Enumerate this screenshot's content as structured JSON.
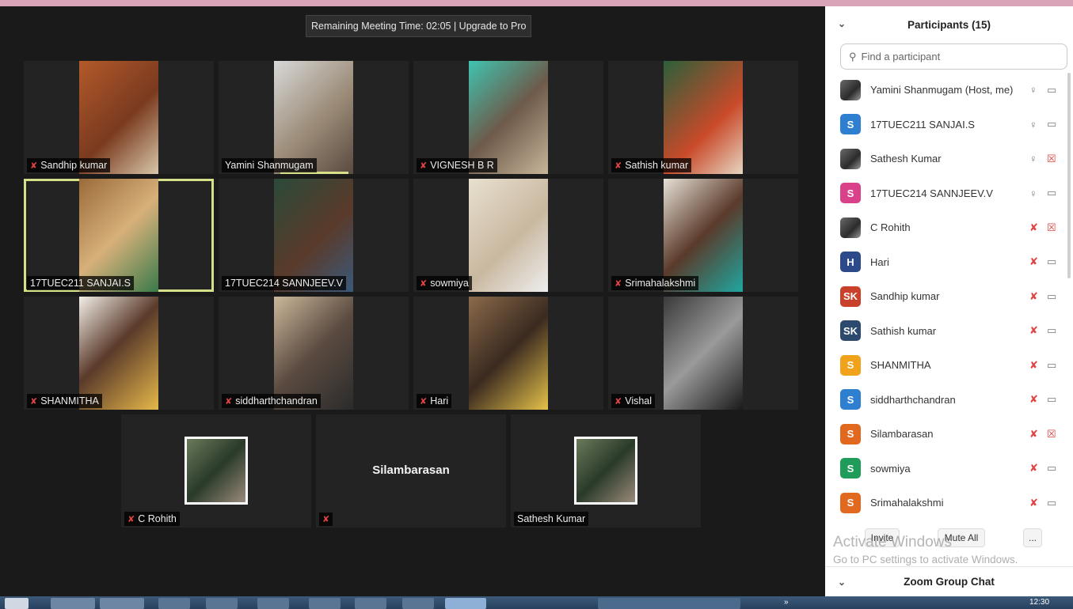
{
  "meeting": {
    "timer": "Remaining Meeting Time: 02:05 | Upgrade to Pro"
  },
  "tiles": [
    {
      "name": "Sandhip kumar",
      "muted": true,
      "video": true,
      "active": false
    },
    {
      "name": "Yamini Shanmugam",
      "muted": false,
      "video": true,
      "active": false
    },
    {
      "name": "VIGNESH B R",
      "muted": true,
      "video": true,
      "active": false
    },
    {
      "name": "Sathish kumar",
      "muted": true,
      "video": true,
      "active": false
    },
    {
      "name": "17TUEC211 SANJAI.S",
      "muted": false,
      "video": true,
      "active": true
    },
    {
      "name": "17TUEC214 SANNJEEV.V",
      "muted": false,
      "video": true,
      "active": false
    },
    {
      "name": "sowmiya",
      "muted": true,
      "video": true,
      "active": false
    },
    {
      "name": "Srimahalakshmi",
      "muted": true,
      "video": true,
      "active": false
    },
    {
      "name": "SHANMITHA",
      "muted": true,
      "video": true,
      "active": false
    },
    {
      "name": "siddharthchandran",
      "muted": true,
      "video": true,
      "active": false
    },
    {
      "name": "Hari",
      "muted": true,
      "video": true,
      "active": false
    },
    {
      "name": "Vishal",
      "muted": true,
      "video": true,
      "active": false
    },
    {
      "name": "C Rohith",
      "muted": true,
      "video": false,
      "active": false
    },
    {
      "name": "",
      "center_name": "Silambarasan",
      "muted": true,
      "video": false,
      "active": false
    },
    {
      "name": "Sathesh Kumar",
      "muted": false,
      "video": false,
      "active": false
    }
  ],
  "panel": {
    "title": "Participants (15)",
    "search_placeholder": "Find a participant",
    "participants": [
      {
        "initials": "",
        "name": "Yamini Shanmugam (Host, me)",
        "color": "#888888",
        "photo": true,
        "mic_off": false,
        "cam_off": false
      },
      {
        "initials": "S",
        "name": "17TUEC211 SANJAI.S",
        "color": "#2f7fd1",
        "photo": false,
        "mic_off": false,
        "cam_off": false
      },
      {
        "initials": "",
        "name": "Sathesh Kumar",
        "color": "#555555",
        "photo": true,
        "mic_off": false,
        "cam_off": true
      },
      {
        "initials": "S",
        "name": "17TUEC214 SANNJEEV.V",
        "color": "#d9418a",
        "photo": false,
        "mic_off": false,
        "cam_off": false
      },
      {
        "initials": "",
        "name": "C Rohith",
        "color": "#777777",
        "photo": true,
        "mic_off": true,
        "cam_off": true
      },
      {
        "initials": "H",
        "name": "Hari",
        "color": "#2c4a8a",
        "photo": false,
        "mic_off": true,
        "cam_off": false
      },
      {
        "initials": "SK",
        "name": "Sandhip kumar",
        "color": "#c9402b",
        "photo": false,
        "mic_off": true,
        "cam_off": false
      },
      {
        "initials": "SK",
        "name": "Sathish kumar",
        "color": "#2c4a6e",
        "photo": false,
        "mic_off": true,
        "cam_off": false
      },
      {
        "initials": "S",
        "name": "SHANMITHA",
        "color": "#f0a21a",
        "photo": false,
        "mic_off": true,
        "cam_off": false
      },
      {
        "initials": "S",
        "name": "siddharthchandran",
        "color": "#2f7fd1",
        "photo": false,
        "mic_off": true,
        "cam_off": false
      },
      {
        "initials": "S",
        "name": "Silambarasan",
        "color": "#e0691f",
        "photo": false,
        "mic_off": true,
        "cam_off": true
      },
      {
        "initials": "S",
        "name": "sowmiya",
        "color": "#1f9c5a",
        "photo": false,
        "mic_off": true,
        "cam_off": false
      },
      {
        "initials": "S",
        "name": "Srimahalakshmi",
        "color": "#e0691f",
        "photo": false,
        "mic_off": true,
        "cam_off": false
      }
    ],
    "invite_label": "Invite",
    "mute_all_label": "Mute All",
    "more_label": "...",
    "watermark_title": "Activate Windows",
    "watermark_sub": "Go to PC settings to activate Windows.",
    "chat_label": "Zoom Group Chat"
  },
  "taskbar": {
    "clock": "12:30",
    "arrows": "»"
  }
}
